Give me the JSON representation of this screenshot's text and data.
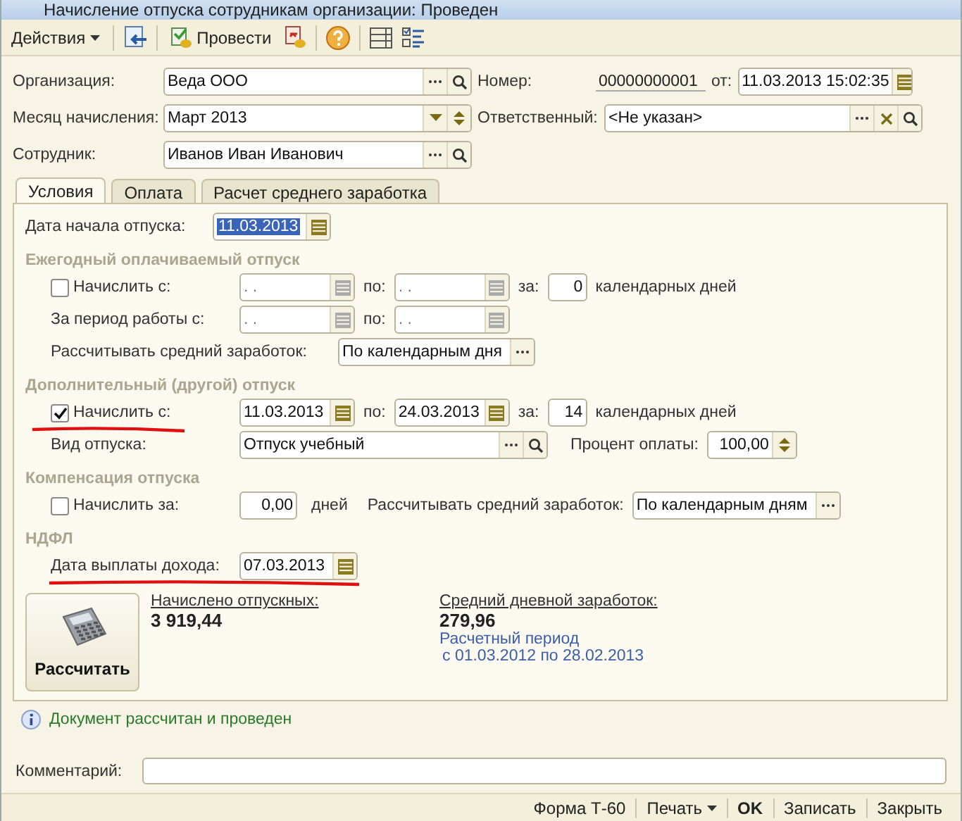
{
  "window": {
    "title": "Начисление отпуска сотрудникам организации: Проведен"
  },
  "toolbar": {
    "actions_menu": "Действия",
    "post_button": "Провести"
  },
  "header": {
    "organization": {
      "label": "Организация:",
      "value": "Веда ООО"
    },
    "month": {
      "label": "Месяц начисления:",
      "value": "Март 2013"
    },
    "employee": {
      "label": "Сотрудник:",
      "value": "Иванов Иван Иванович"
    },
    "number": {
      "label": "Номер:",
      "value": "00000000001"
    },
    "date": {
      "label": "от:",
      "value": "11.03.2013 15:02:35"
    },
    "responsible": {
      "label": "Ответственный:",
      "value": "<Не указан>"
    }
  },
  "tabs": [
    {
      "label": "Условия",
      "selected": true
    },
    {
      "label": "Оплата",
      "selected": false
    },
    {
      "label": "Расчет среднего заработка",
      "selected": false
    }
  ],
  "start_date": {
    "label": "Дата начала отпуска:",
    "value": "11.03.2013"
  },
  "annual": {
    "title": "Ежегодный оплачиваемый отпуск",
    "accrue": {
      "label": "Начислить с:",
      "checked": false,
      "disabled": true,
      "from": ". .",
      "to_label": "по:",
      "to": ". .",
      "days_label": "за:",
      "days": "0",
      "unit": "календарных дней"
    },
    "period": {
      "label": "За период работы с:",
      "disabled": true,
      "from": ". .",
      "to_label": "по:",
      "to": ". ."
    },
    "average": {
      "label": "Рассчитывать средний заработок:",
      "value": "По календарным дня"
    }
  },
  "additional": {
    "title": "Дополнительный (другой) отпуск",
    "accrue": {
      "label": "Начислить с:",
      "checked": true,
      "disabled": false,
      "from": "11.03.2013",
      "to_label": "по:",
      "to": "24.03.2013",
      "days_label": "за:",
      "days": "14",
      "unit": "календарных дней"
    },
    "type": {
      "label": "Вид отпуска:",
      "value": "Отпуск учебный"
    },
    "percent": {
      "label": "Процент оплаты:",
      "value": "100,00"
    }
  },
  "compensation": {
    "title": "Компенсация отпуска",
    "accrue": {
      "label": "Начислить за:",
      "checked": false,
      "days": "0,00",
      "unit": "дней"
    },
    "average": {
      "label": "Рассчитывать средний заработок:",
      "value": "По календарным дням"
    }
  },
  "ndfl": {
    "title": "НДФЛ",
    "payment_date": {
      "label": "Дата выплаты дохода:",
      "value": "07.03.2013"
    }
  },
  "calculate_button": "Рассчитать",
  "accrued": {
    "label": "Начислено отпускных:",
    "value": "3 919,44"
  },
  "average_daily": {
    "label": "Средний дневной заработок:",
    "value": "279,96",
    "period_label": "Расчетный период",
    "period": "с 01.03.2012 по 28.02.2013"
  },
  "info": "Документ рассчитан и проведен",
  "comment": {
    "label": "Комментарий:"
  },
  "footer": [
    {
      "label": "Форма Т-60",
      "kind": "plain"
    },
    {
      "label": "Печать",
      "kind": "menu"
    },
    {
      "label": "OK",
      "kind": "default"
    },
    {
      "label": "Записать",
      "kind": "plain"
    },
    {
      "label": "Закрыть",
      "kind": "plain"
    }
  ]
}
